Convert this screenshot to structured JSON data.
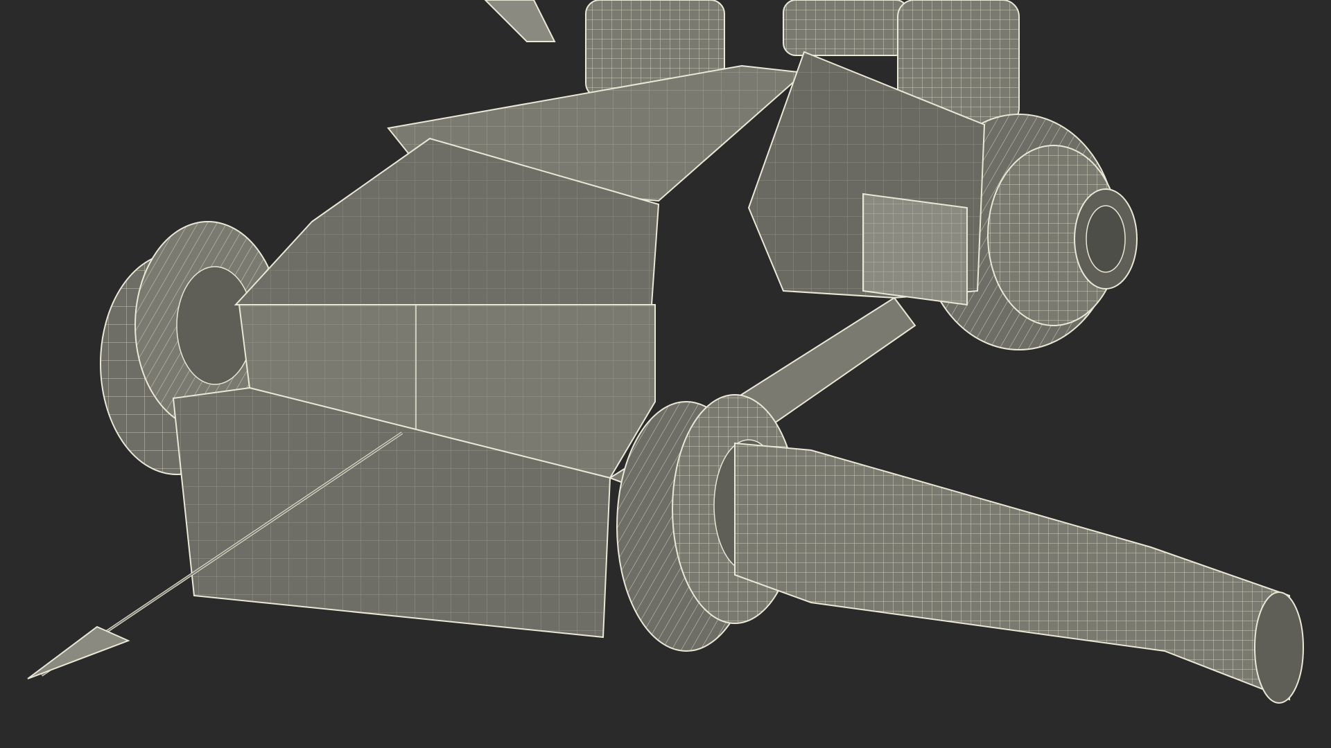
{
  "scene": {
    "subject": "wireframe-render",
    "colors": {
      "background": "#2a2a2a",
      "surface": "#7a7a70",
      "surface_dark": "#5f5f57",
      "surface_light": "#8a8a80",
      "wire": "#eae8d6",
      "shadow": "#1e1e1e"
    }
  }
}
